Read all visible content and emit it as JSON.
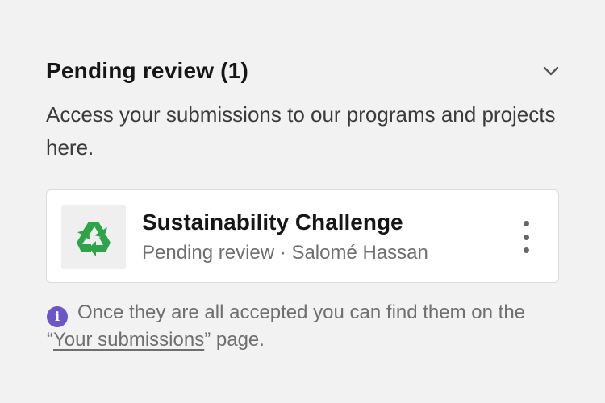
{
  "section": {
    "title": "Pending review (1)",
    "description": "Access your submissions to our programs and projects here."
  },
  "submission": {
    "icon": "recycle-icon",
    "title": "Sustainability Challenge",
    "status": "Pending review",
    "separator": " · ",
    "author": "Salomé Hassan"
  },
  "note": {
    "icon": "info-icon",
    "icon_glyph": "i",
    "text_before": "Once they are all accepted you can find them on the “",
    "link_label": "Your submissions",
    "text_after": "” page."
  },
  "colors": {
    "background": "#f2f2f2",
    "card": "#ffffff",
    "info_accent": "#6b55c8",
    "recycle_green": "#2fa34a"
  }
}
